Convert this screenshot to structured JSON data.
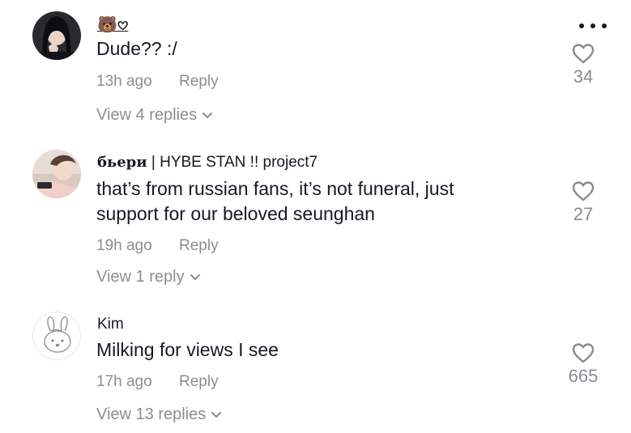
{
  "comments": [
    {
      "username": "🐻𖹭",
      "text": "Dude?? :/",
      "time": "13h ago",
      "reply_label": "Reply",
      "likes": "34",
      "view_replies": "View 4 replies"
    },
    {
      "username_prefix": "бьери",
      "username": " | HYBE STAN !! project7",
      "text": "that’s from russian fans, it’s not funeral, just support for our beloved seunghan",
      "time": "19h ago",
      "reply_label": "Reply",
      "likes": "27",
      "view_replies": "View 1 reply"
    },
    {
      "username": "Kim",
      "text": "Milking for views I see",
      "time": "17h ago",
      "reply_label": "Reply",
      "likes": "665",
      "view_replies": "View 13 replies"
    }
  ],
  "icons": {
    "more": "more-horizontal-icon",
    "like": "heart-outline-icon",
    "expand": "chevron-down-icon"
  },
  "colors": {
    "primary_text": "#161823",
    "secondary_text": "#8a8b91"
  }
}
